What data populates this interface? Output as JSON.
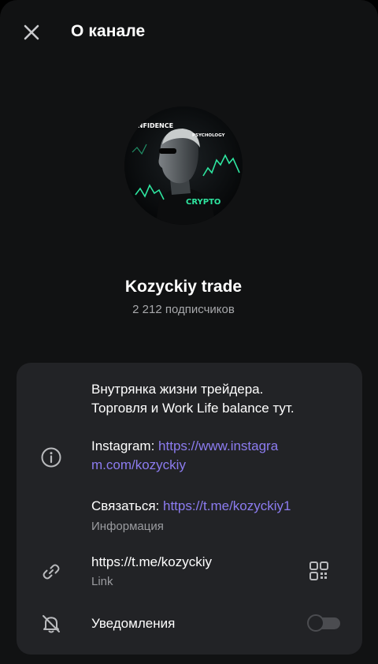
{
  "header": {
    "title": "О канале",
    "close_icon": "close-icon"
  },
  "avatar": {
    "words": {
      "confidence": "ONFIDENCE",
      "psychology": "PSYCHOLOGY",
      "crypto": "CRYPTO"
    },
    "accent_color": "#2ee6a0"
  },
  "channel": {
    "name": "Kozyckiy trade",
    "subscribers": "2 212 подписчиков"
  },
  "info": {
    "description_line1": "Внутрянка жизни трейдера.",
    "description_line2": "Торговля и Work Life balance тут.",
    "instagram_label": "Instagram: ",
    "instagram_link_part1": "https://www.instagra",
    "instagram_link_part2": "m.com/kozyckiy",
    "contact_label": "Связаться: ",
    "contact_link": "https://t.me/kozyckiy1",
    "info_caption": "Информация",
    "icon": "info-icon"
  },
  "link_row": {
    "url": "https://t.me/kozyckiy",
    "caption": "Link",
    "icon": "link-icon",
    "qr_icon": "qr-code-icon"
  },
  "notifications": {
    "label": "Уведомления",
    "icon": "bell-off-icon",
    "enabled": false
  },
  "colors": {
    "background": "#111213",
    "card": "#222326",
    "link": "#8c7cf0",
    "secondary_text": "#9b9ca0"
  }
}
